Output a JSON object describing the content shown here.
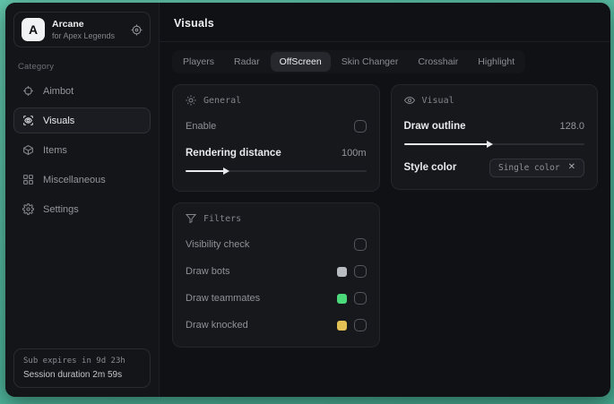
{
  "sidebar": {
    "logo_letter": "A",
    "app_name": "Arcane",
    "app_subtitle": "for Apex Legends",
    "category_label": "Category",
    "items": [
      {
        "label": "Aimbot"
      },
      {
        "label": "Visuals"
      },
      {
        "label": "Items"
      },
      {
        "label": "Miscellaneous"
      },
      {
        "label": "Settings"
      }
    ],
    "footer": {
      "sub_expires": "Sub expires in 9d 23h",
      "session_duration": "Session duration 2m 59s"
    }
  },
  "header": {
    "title": "Visuals"
  },
  "tabs": [
    {
      "label": "Players"
    },
    {
      "label": "Radar"
    },
    {
      "label": "OffScreen"
    },
    {
      "label": "Skin Changer"
    },
    {
      "label": "Crosshair"
    },
    {
      "label": "Highlight"
    }
  ],
  "cards": {
    "general": {
      "title": "General",
      "enable_label": "Enable",
      "enable_checked": false,
      "rendering_distance_label": "Rendering distance",
      "rendering_distance_value": "100m",
      "rendering_distance_percent": 22
    },
    "visual": {
      "title": "Visual",
      "draw_outline_label": "Draw outline",
      "draw_outline_value": "128.0",
      "draw_outline_percent": 47,
      "style_color_label": "Style color",
      "style_color_value": "Single color"
    },
    "filters": {
      "title": "Filters",
      "rows": [
        {
          "label": "Visibility check",
          "swatch": "",
          "checked": false
        },
        {
          "label": "Draw bots",
          "swatch": "#b9bcc1",
          "checked": false
        },
        {
          "label": "Draw teammates",
          "swatch": "#4cd97a",
          "checked": false
        },
        {
          "label": "Draw knocked",
          "swatch": "#e3c155",
          "checked": false
        }
      ]
    }
  },
  "colors": {
    "desktop_teal": "#4fb59b",
    "window_bg": "#101114",
    "card_bg": "#17181c",
    "accent_white": "#e9eaec"
  }
}
